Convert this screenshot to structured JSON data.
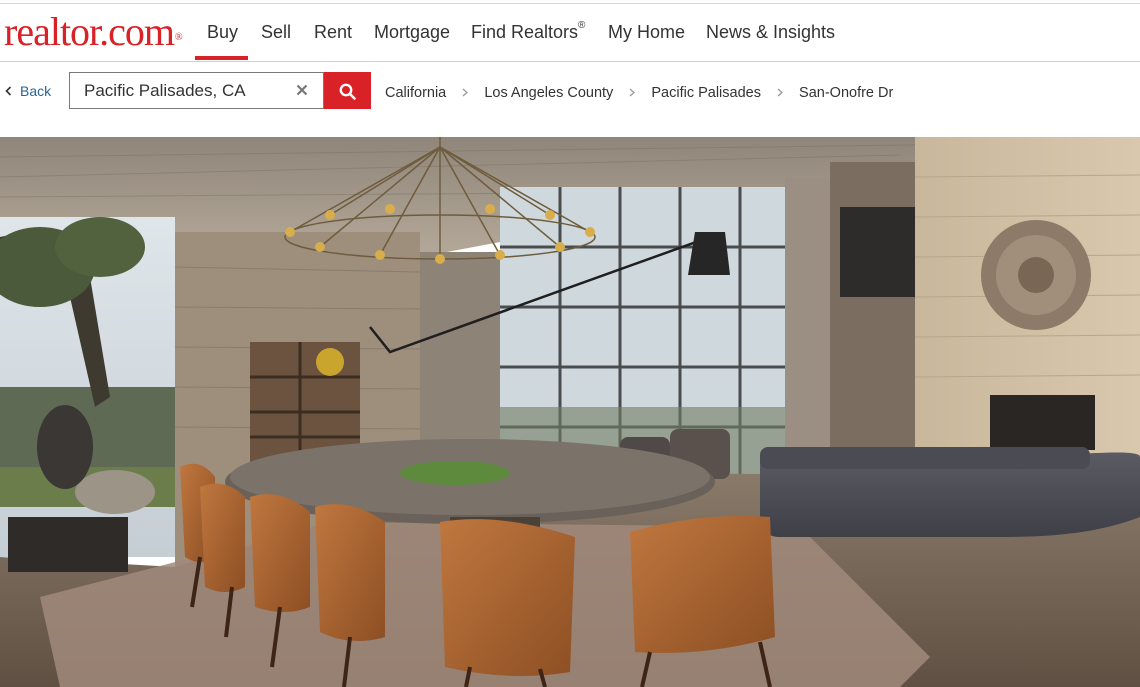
{
  "brand": {
    "logo_text": "realtor.com",
    "logo_mark": "®",
    "color": "#d92228"
  },
  "nav": {
    "items": [
      {
        "label": "Buy"
      },
      {
        "label": "Sell"
      },
      {
        "label": "Rent"
      },
      {
        "label": "Mortgage"
      },
      {
        "label": "Find Realtors",
        "mark": "®"
      },
      {
        "label": "My Home"
      },
      {
        "label": "News & Insights"
      }
    ],
    "active": "Buy"
  },
  "back": {
    "label": "Back",
    "icon": "chevron-left-icon"
  },
  "search": {
    "value": "Pacific Palisades, CA",
    "clear_icon": "close-icon",
    "button_icon": "search-icon"
  },
  "breadcrumb": [
    {
      "label": "California"
    },
    {
      "label": "Los Angeles County"
    },
    {
      "label": "Pacific Palisades"
    },
    {
      "label": "San-Onofre Dr"
    }
  ],
  "colors": {
    "accent": "#d92228",
    "link": "#2a6496"
  }
}
